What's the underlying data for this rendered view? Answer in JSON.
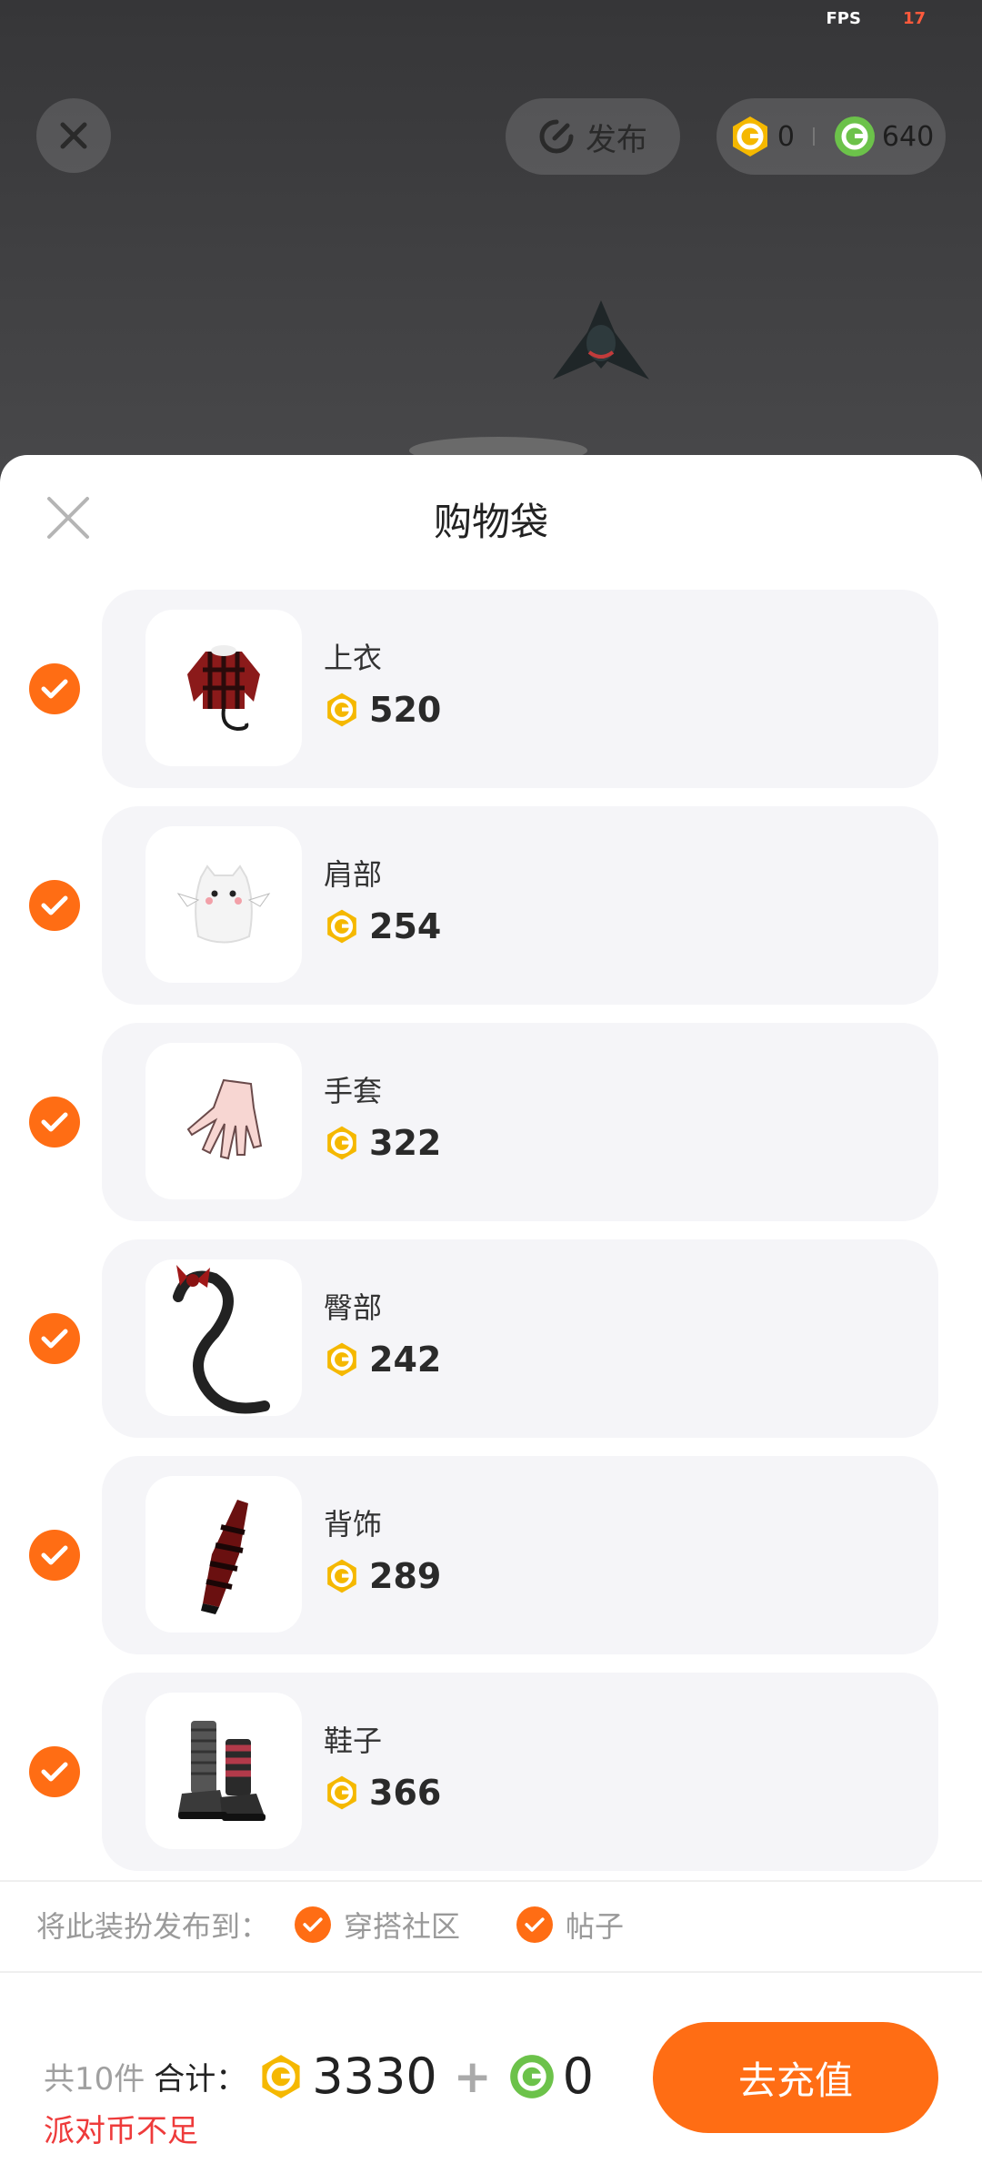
{
  "status": {
    "fps_label": "FPS",
    "fps_value": "17"
  },
  "top": {
    "publish_label": "发布",
    "gold_amount": "0",
    "green_amount": "640"
  },
  "sheet": {
    "title": "购物袋"
  },
  "items": [
    {
      "name": "上衣",
      "price": "520",
      "thumb_icon": "coat-icon"
    },
    {
      "name": "肩部",
      "price": "254",
      "thumb_icon": "ghost-cat-icon"
    },
    {
      "name": "手套",
      "price": "322",
      "thumb_icon": "hand-icon"
    },
    {
      "name": "臀部",
      "price": "242",
      "thumb_icon": "tail-icon"
    },
    {
      "name": "背饰",
      "price": "289",
      "thumb_icon": "back-accessory-icon"
    },
    {
      "name": "鞋子",
      "price": "366",
      "thumb_icon": "boots-icon"
    }
  ],
  "share": {
    "label": "将此装扮发布到：",
    "options": [
      "穿搭社区",
      "帖子"
    ]
  },
  "footer": {
    "count_label": "共10件",
    "total_label": "合计：",
    "gold_total": "3330",
    "plus": "+",
    "green_total": "0",
    "warning": "派对币不足",
    "recharge_label": "去充值"
  },
  "colors": {
    "accent": "#ff6d14",
    "warning": "#ee3b3b",
    "gold": "#f5b800",
    "green": "#6cc24a"
  }
}
